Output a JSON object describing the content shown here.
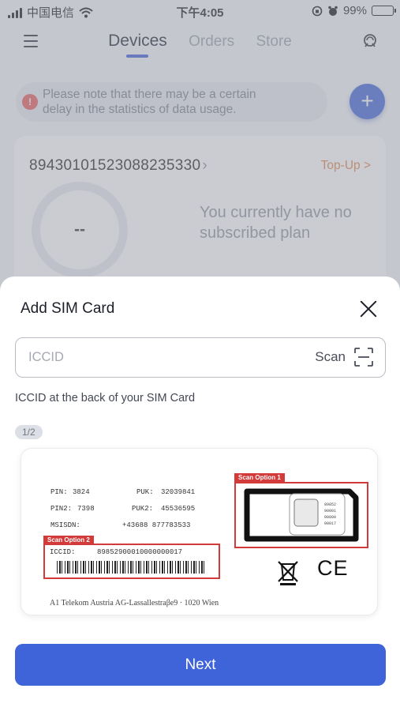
{
  "status_bar": {
    "carrier": "中国电信",
    "time": "下午4:05",
    "battery": "99%",
    "battery_level": 0.99
  },
  "nav": {
    "tabs": [
      {
        "label": "Devices",
        "active": true
      },
      {
        "label": "Orders",
        "active": false
      },
      {
        "label": "Store",
        "active": false
      }
    ]
  },
  "notice": {
    "text": "Please note that there may be a certain delay in the statistics of data usage."
  },
  "sim_card": {
    "iccid": "89430101523088235330",
    "chevron": "›",
    "top_up_label": "Top-Up >",
    "usage_value": "--",
    "plan_message": "You currently have no subscribed plan"
  },
  "sheet": {
    "title": "Add SIM Card",
    "iccid_placeholder": "ICCID",
    "iccid_value": "",
    "scan_label": "Scan",
    "hint": "ICCID at the back of your SIM Card",
    "page_indicator": "1/2",
    "next_label": "Next"
  },
  "guide_card": {
    "pin_label": "PIN:",
    "pin_value": "3824",
    "puk_label": "PUK:",
    "puk_value": "32039841",
    "pin2_label": "PIN2:",
    "pin2_value": "7398",
    "puk2_label": "PUK2:",
    "puk2_value": "45536595",
    "msisdn_label": "MSISDN:",
    "msisdn_value": "+43688 877783533",
    "iccid_label": "ICCID:",
    "iccid_value": "89852900010000000017",
    "scan_option_1": "Scan Option 1",
    "scan_option_2": "Scan Option 2",
    "address": "A1 Telekom Austria AG-Lassallestraβe9 · 1020 Wien",
    "ce_mark": "CE",
    "chip_lines": [
      "89852",
      "90001",
      "00000",
      "00017"
    ]
  },
  "colors": {
    "accent": "#3f63d8",
    "top_up": "#e0824a",
    "alert": "#e85a5a",
    "scan_box": "#d33a3a"
  },
  "icons": [
    "menu-icon",
    "support-icon",
    "alert-icon",
    "plus-icon",
    "chevron-right-icon",
    "close-icon",
    "scan-icon",
    "weee-icon"
  ]
}
